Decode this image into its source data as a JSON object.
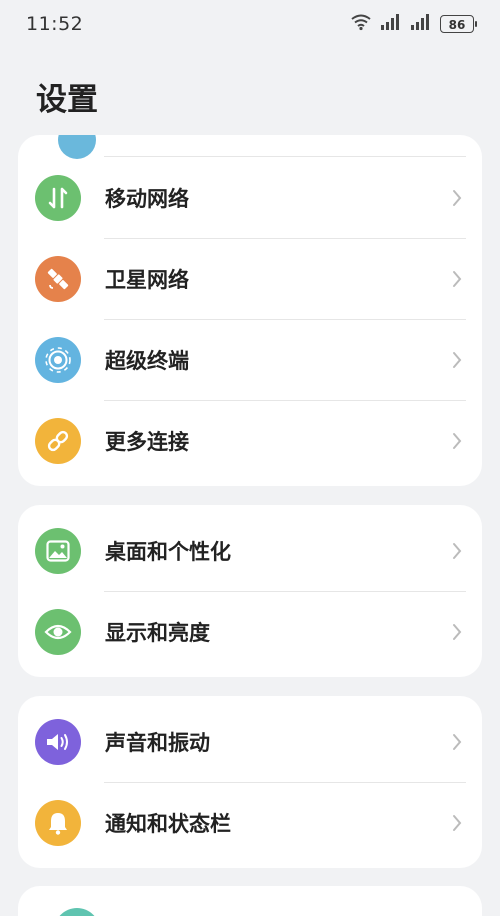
{
  "status": {
    "time": "11:52",
    "battery": "86"
  },
  "title": "设置",
  "groups": [
    {
      "items": [
        {
          "label": "移动网络",
          "icon": "mobile-data-icon",
          "color": "#6cc070"
        },
        {
          "label": "卫星网络",
          "icon": "satellite-icon",
          "color": "#e5824b"
        },
        {
          "label": "超级终端",
          "icon": "super-device-icon",
          "color": "#63b4e0"
        },
        {
          "label": "更多连接",
          "icon": "link-icon",
          "color": "#f2b43b"
        }
      ]
    },
    {
      "items": [
        {
          "label": "桌面和个性化",
          "icon": "wallpaper-icon",
          "color": "#6cc070"
        },
        {
          "label": "显示和亮度",
          "icon": "eye-icon",
          "color": "#6cc070"
        }
      ]
    },
    {
      "items": [
        {
          "label": "声音和振动",
          "icon": "volume-icon",
          "color": "#7e62dc"
        },
        {
          "label": "通知和状态栏",
          "icon": "bell-icon",
          "color": "#f2b43b"
        }
      ]
    }
  ]
}
